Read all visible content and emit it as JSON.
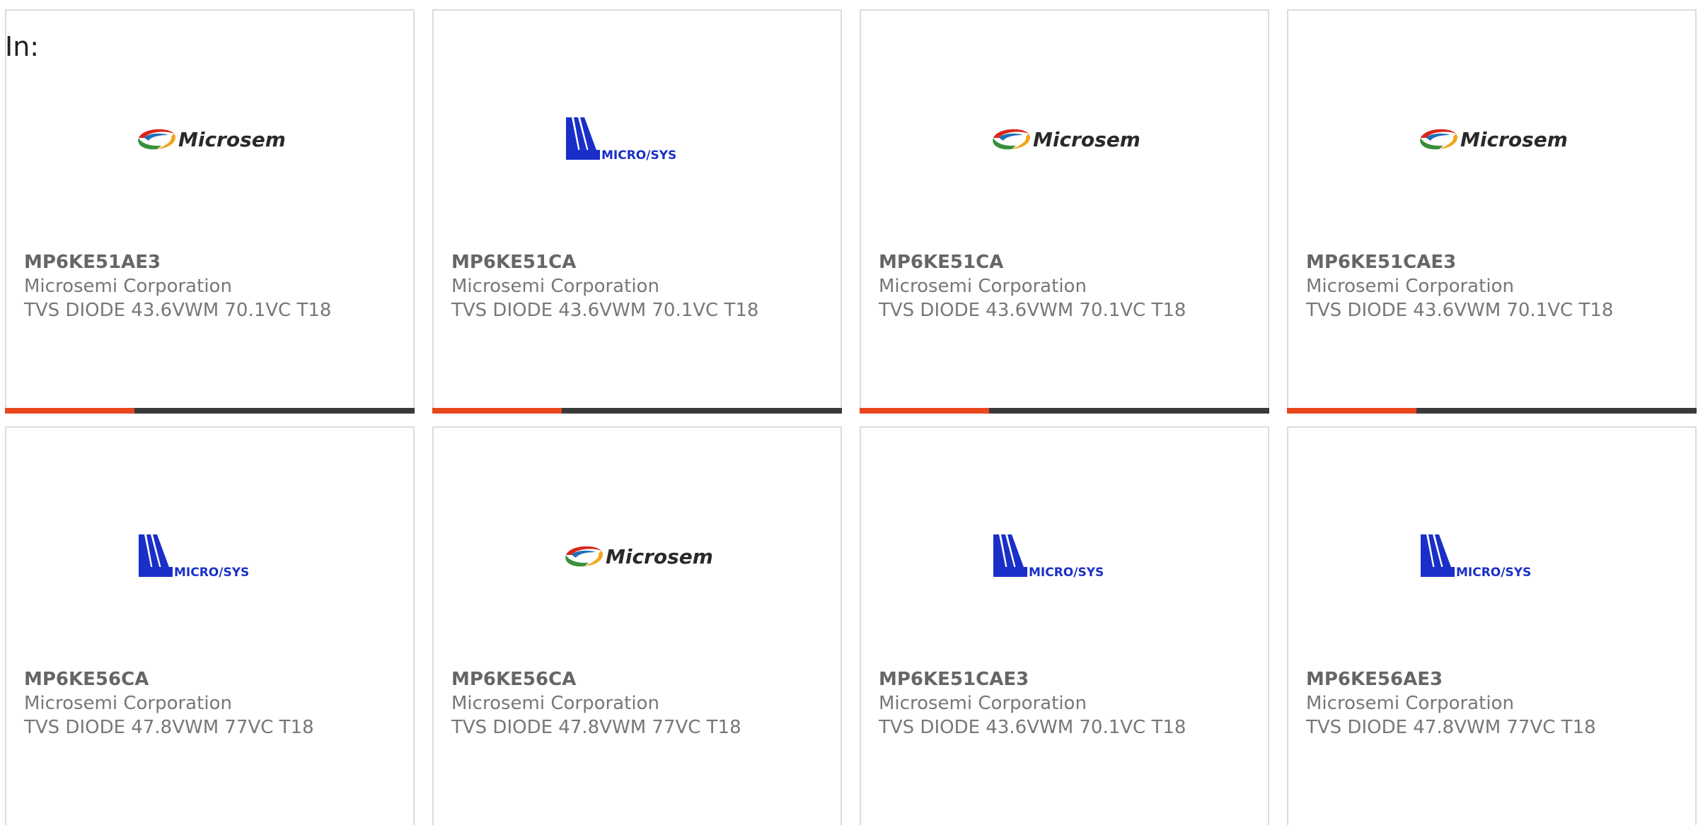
{
  "label": "In:",
  "colors": {
    "accent": "#e8461c",
    "bar": "#3a3a3a",
    "microsys_blue": "#1a2fc7"
  },
  "logos": {
    "microsemi": "Microsemi",
    "microsys": "MICRO/SYS"
  },
  "cards": [
    {
      "logo": "microsemi",
      "part": "MP6KE51AE3",
      "manufacturer": "Microsemi Corporation",
      "description": "TVS DIODE 43.6VWM 70.1VC T18"
    },
    {
      "logo": "microsys",
      "part": "MP6KE51CA",
      "manufacturer": "Microsemi Corporation",
      "description": "TVS DIODE 43.6VWM 70.1VC T18"
    },
    {
      "logo": "microsemi",
      "part": "MP6KE51CA",
      "manufacturer": "Microsemi Corporation",
      "description": "TVS DIODE 43.6VWM 70.1VC T18"
    },
    {
      "logo": "microsemi",
      "part": "MP6KE51CAE3",
      "manufacturer": "Microsemi Corporation",
      "description": "TVS DIODE 43.6VWM 70.1VC T18"
    },
    {
      "logo": "microsys",
      "part": "MP6KE56CA",
      "manufacturer": "Microsemi Corporation",
      "description": "TVS DIODE 47.8VWM 77VC T18"
    },
    {
      "logo": "microsemi",
      "part": "MP6KE56CA",
      "manufacturer": "Microsemi Corporation",
      "description": "TVS DIODE 47.8VWM 77VC T18"
    },
    {
      "logo": "microsys",
      "part": "MP6KE51CAE3",
      "manufacturer": "Microsemi Corporation",
      "description": "TVS DIODE 43.6VWM 70.1VC T18"
    },
    {
      "logo": "microsys",
      "part": "MP6KE56AE3",
      "manufacturer": "Microsemi Corporation",
      "description": "TVS DIODE 47.8VWM 77VC T18"
    }
  ]
}
